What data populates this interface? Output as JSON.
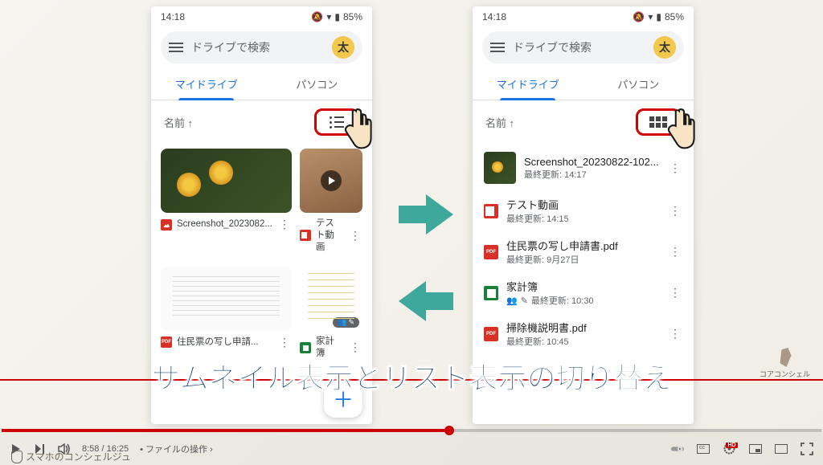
{
  "status": {
    "time": "14:18",
    "battery": "85%"
  },
  "search": {
    "placeholder": "ドライブで検索",
    "avatar": "太"
  },
  "tabs": {
    "mydrive": "マイドライブ",
    "computer": "パソコン"
  },
  "sort_label": "名前 ↑",
  "grid_items": [
    {
      "title": "Screenshot_2023082...",
      "type": "img"
    },
    {
      "title": "テスト動画",
      "type": "vid"
    },
    {
      "title": "住民票の写し申請...",
      "type": "pdf"
    },
    {
      "title": "家計簿",
      "type": "sheet"
    }
  ],
  "list_items": [
    {
      "title": "Screenshot_20230822-102...",
      "sub": "最終更新: 14:17",
      "type": "thumb"
    },
    {
      "title": "テスト動画",
      "sub": "最終更新: 14:15",
      "type": "vid"
    },
    {
      "title": "住民票の写し申請書.pdf",
      "sub": "最終更新: 9月27日",
      "type": "pdf"
    },
    {
      "title": "家計簿",
      "sub": "最終更新: 10:30",
      "type": "sheet",
      "shared": true
    },
    {
      "title": "掃除機説明書.pdf",
      "sub": "最終更新: 10:45",
      "type": "pdf"
    }
  ],
  "share_icons": "👥",
  "caption": "サムネイル表示とリスト表示の切り替え",
  "brand": "コアコンシェル",
  "player": {
    "time_current": "8:58",
    "time_total": "16:25",
    "chapter": "ファイルの操作",
    "watermark": "スマホのコンシェルジュ",
    "hd": "HD"
  }
}
